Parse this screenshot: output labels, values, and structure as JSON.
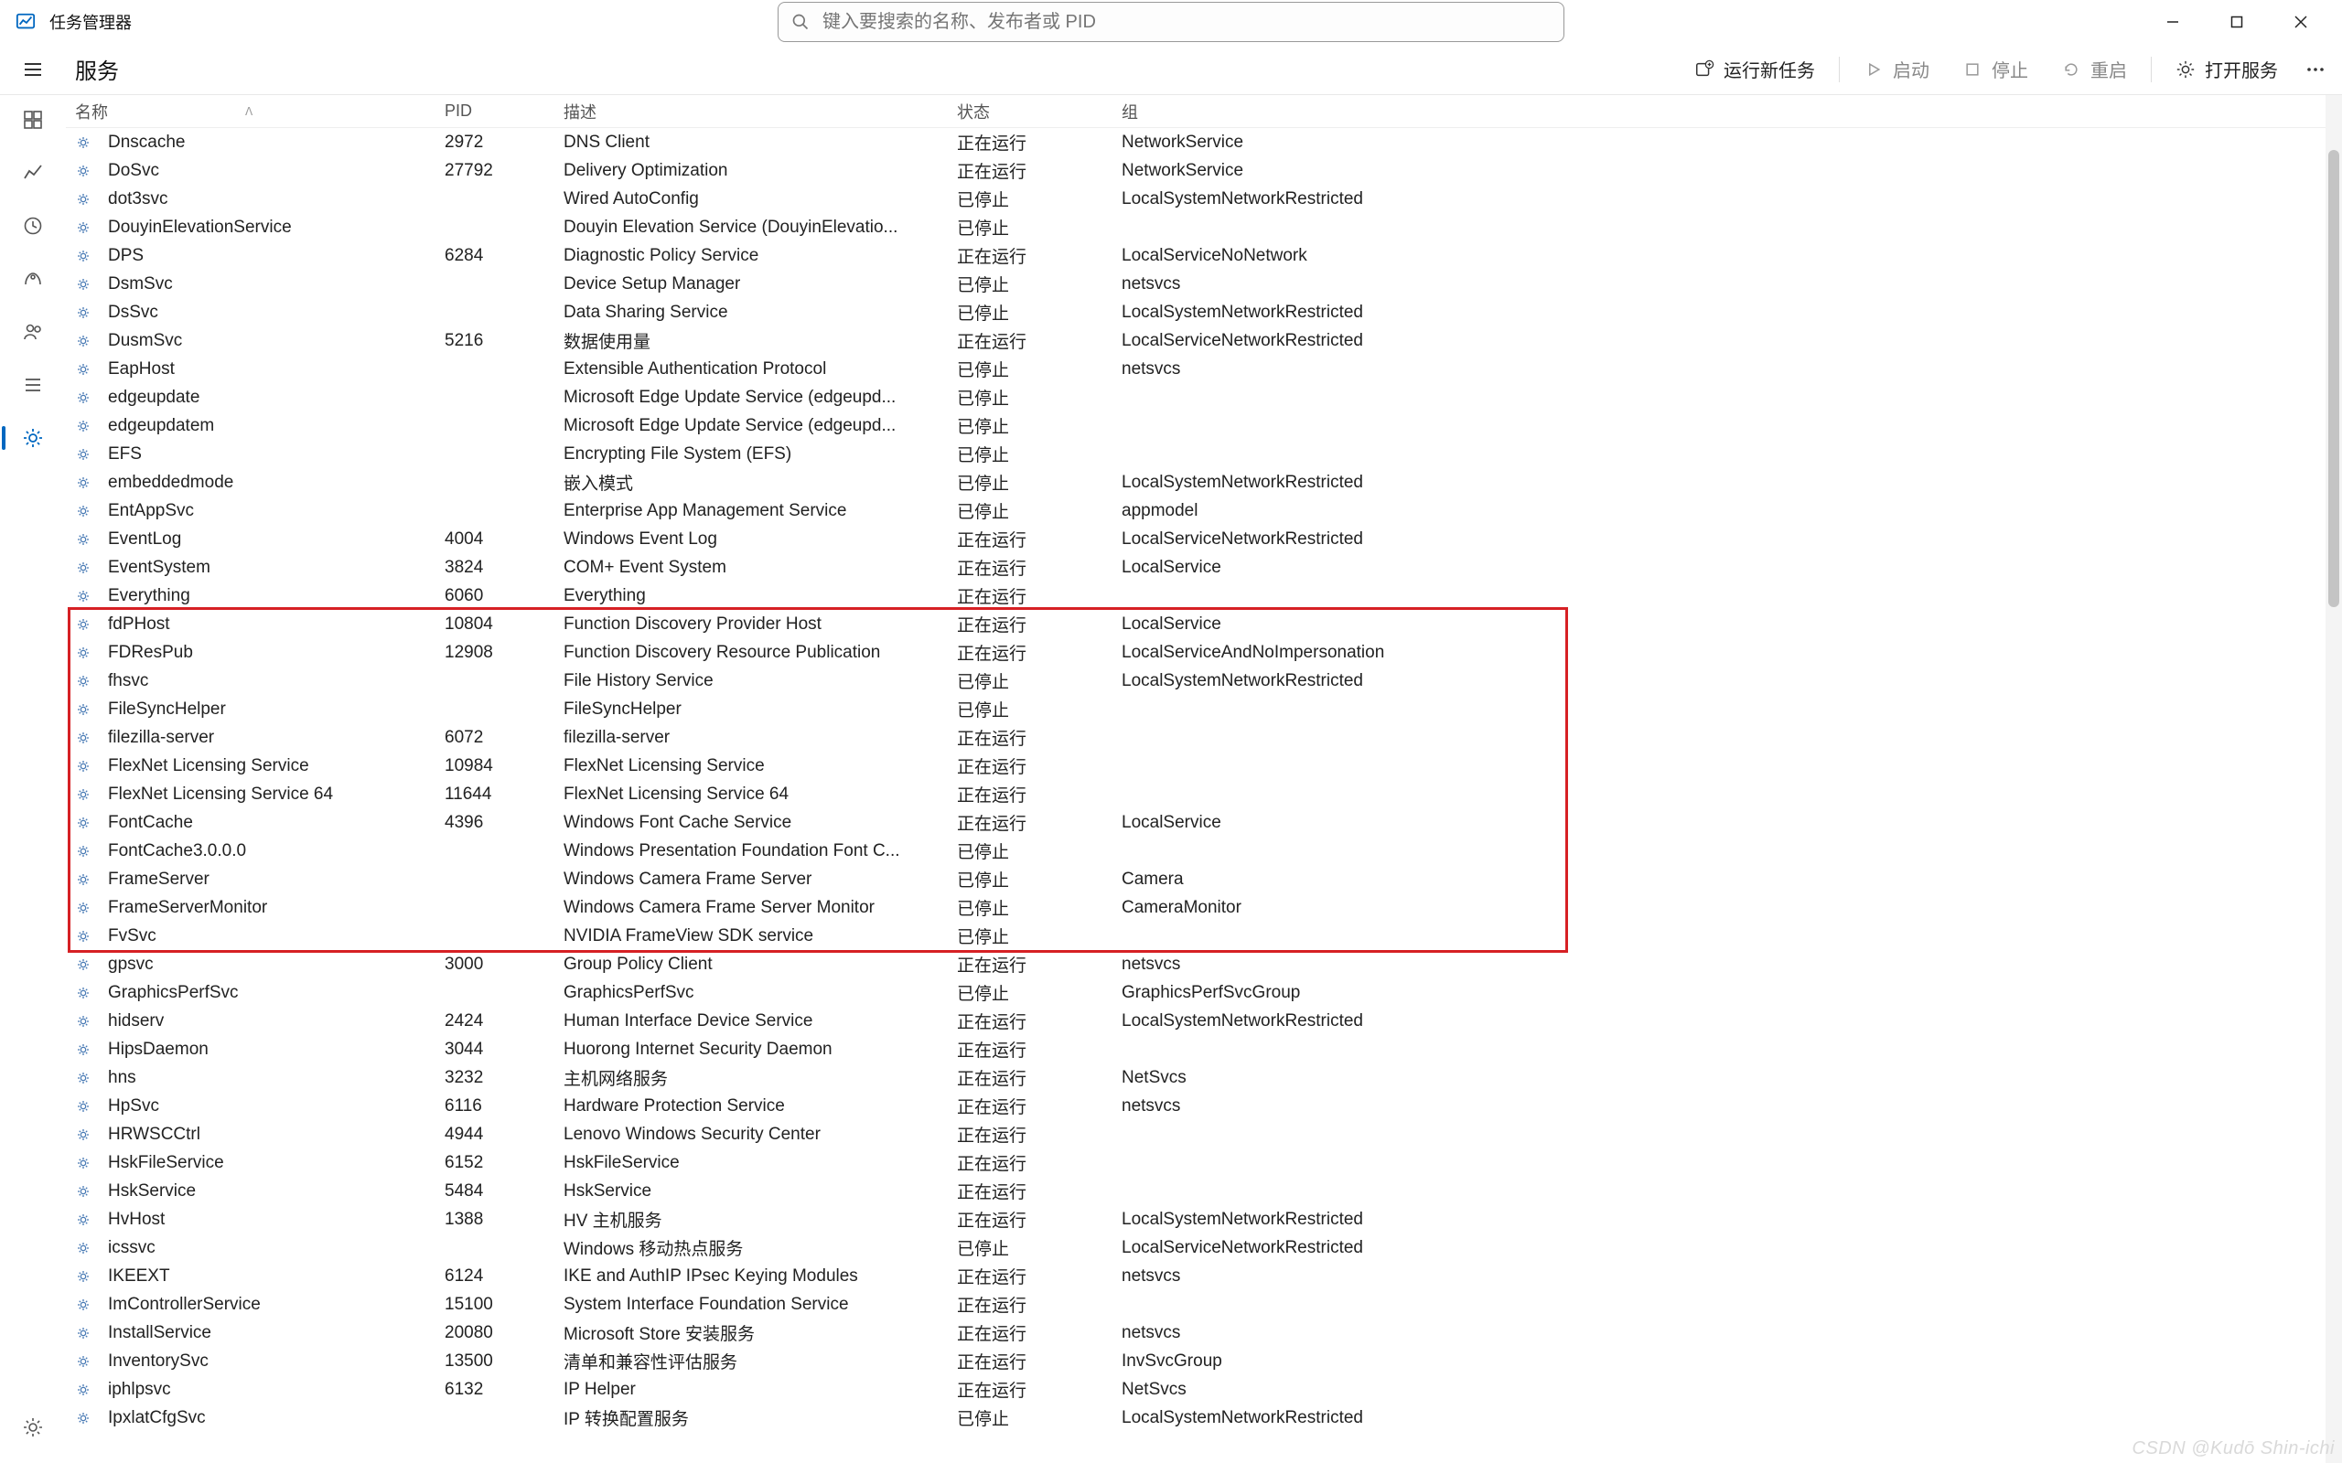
{
  "window": {
    "title": "任务管理器"
  },
  "search": {
    "placeholder": "键入要搜索的名称、发布者或 PID"
  },
  "page": {
    "title": "服务"
  },
  "actions": {
    "new_task": "运行新任务",
    "start": "启动",
    "stop": "停止",
    "restart": "重启",
    "open_services": "打开服务"
  },
  "columns": {
    "name": "名称",
    "pid": "PID",
    "desc": "描述",
    "status": "状态",
    "group": "组"
  },
  "status_labels": {
    "running": "正在运行",
    "stopped": "已停止"
  },
  "watermark": "CSDN @Kudō Shin-ichi",
  "highlight": {
    "startIndex": 17,
    "endIndex": 28
  },
  "services": [
    {
      "name": "Dnscache",
      "pid": "2972",
      "desc": "DNS Client",
      "status": "running",
      "group": "NetworkService"
    },
    {
      "name": "DoSvc",
      "pid": "27792",
      "desc": "Delivery Optimization",
      "status": "running",
      "group": "NetworkService"
    },
    {
      "name": "dot3svc",
      "pid": "",
      "desc": "Wired AutoConfig",
      "status": "stopped",
      "group": "LocalSystemNetworkRestricted"
    },
    {
      "name": "DouyinElevationService",
      "pid": "",
      "desc": "Douyin Elevation Service (DouyinElevatio...",
      "status": "stopped",
      "group": ""
    },
    {
      "name": "DPS",
      "pid": "6284",
      "desc": "Diagnostic Policy Service",
      "status": "running",
      "group": "LocalServiceNoNetwork"
    },
    {
      "name": "DsmSvc",
      "pid": "",
      "desc": "Device Setup Manager",
      "status": "stopped",
      "group": "netsvcs"
    },
    {
      "name": "DsSvc",
      "pid": "",
      "desc": "Data Sharing Service",
      "status": "stopped",
      "group": "LocalSystemNetworkRestricted"
    },
    {
      "name": "DusmSvc",
      "pid": "5216",
      "desc": "数据使用量",
      "status": "running",
      "group": "LocalServiceNetworkRestricted"
    },
    {
      "name": "EapHost",
      "pid": "",
      "desc": "Extensible Authentication Protocol",
      "status": "stopped",
      "group": "netsvcs"
    },
    {
      "name": "edgeupdate",
      "pid": "",
      "desc": "Microsoft Edge Update Service (edgeupd...",
      "status": "stopped",
      "group": ""
    },
    {
      "name": "edgeupdatem",
      "pid": "",
      "desc": "Microsoft Edge Update Service (edgeupd...",
      "status": "stopped",
      "group": ""
    },
    {
      "name": "EFS",
      "pid": "",
      "desc": "Encrypting File System (EFS)",
      "status": "stopped",
      "group": ""
    },
    {
      "name": "embeddedmode",
      "pid": "",
      "desc": "嵌入模式",
      "status": "stopped",
      "group": "LocalSystemNetworkRestricted"
    },
    {
      "name": "EntAppSvc",
      "pid": "",
      "desc": "Enterprise App Management Service",
      "status": "stopped",
      "group": "appmodel"
    },
    {
      "name": "EventLog",
      "pid": "4004",
      "desc": "Windows Event Log",
      "status": "running",
      "group": "LocalServiceNetworkRestricted"
    },
    {
      "name": "EventSystem",
      "pid": "3824",
      "desc": "COM+ Event System",
      "status": "running",
      "group": "LocalService"
    },
    {
      "name": "Everything",
      "pid": "6060",
      "desc": "Everything",
      "status": "running",
      "group": ""
    },
    {
      "name": "fdPHost",
      "pid": "10804",
      "desc": "Function Discovery Provider Host",
      "status": "running",
      "group": "LocalService"
    },
    {
      "name": "FDResPub",
      "pid": "12908",
      "desc": "Function Discovery Resource Publication",
      "status": "running",
      "group": "LocalServiceAndNoImpersonation"
    },
    {
      "name": "fhsvc",
      "pid": "",
      "desc": "File History Service",
      "status": "stopped",
      "group": "LocalSystemNetworkRestricted"
    },
    {
      "name": "FileSyncHelper",
      "pid": "",
      "desc": "FileSyncHelper",
      "status": "stopped",
      "group": ""
    },
    {
      "name": "filezilla-server",
      "pid": "6072",
      "desc": "filezilla-server",
      "status": "running",
      "group": ""
    },
    {
      "name": "FlexNet Licensing Service",
      "pid": "10984",
      "desc": "FlexNet Licensing Service",
      "status": "running",
      "group": ""
    },
    {
      "name": "FlexNet Licensing Service 64",
      "pid": "11644",
      "desc": "FlexNet Licensing Service 64",
      "status": "running",
      "group": ""
    },
    {
      "name": "FontCache",
      "pid": "4396",
      "desc": "Windows Font Cache Service",
      "status": "running",
      "group": "LocalService"
    },
    {
      "name": "FontCache3.0.0.0",
      "pid": "",
      "desc": "Windows Presentation Foundation Font C...",
      "status": "stopped",
      "group": ""
    },
    {
      "name": "FrameServer",
      "pid": "",
      "desc": "Windows Camera Frame Server",
      "status": "stopped",
      "group": "Camera"
    },
    {
      "name": "FrameServerMonitor",
      "pid": "",
      "desc": "Windows Camera Frame Server Monitor",
      "status": "stopped",
      "group": "CameraMonitor"
    },
    {
      "name": "FvSvc",
      "pid": "",
      "desc": "NVIDIA FrameView SDK service",
      "status": "stopped",
      "group": ""
    },
    {
      "name": "gpsvc",
      "pid": "3000",
      "desc": "Group Policy Client",
      "status": "running",
      "group": "netsvcs"
    },
    {
      "name": "GraphicsPerfSvc",
      "pid": "",
      "desc": "GraphicsPerfSvc",
      "status": "stopped",
      "group": "GraphicsPerfSvcGroup"
    },
    {
      "name": "hidserv",
      "pid": "2424",
      "desc": "Human Interface Device Service",
      "status": "running",
      "group": "LocalSystemNetworkRestricted"
    },
    {
      "name": "HipsDaemon",
      "pid": "3044",
      "desc": "Huorong Internet Security Daemon",
      "status": "running",
      "group": ""
    },
    {
      "name": "hns",
      "pid": "3232",
      "desc": "主机网络服务",
      "status": "running",
      "group": "NetSvcs"
    },
    {
      "name": "HpSvc",
      "pid": "6116",
      "desc": "Hardware Protection Service",
      "status": "running",
      "group": "netsvcs"
    },
    {
      "name": "HRWSCCtrl",
      "pid": "4944",
      "desc": "Lenovo Windows Security Center",
      "status": "running",
      "group": ""
    },
    {
      "name": "HskFileService",
      "pid": "6152",
      "desc": "HskFileService",
      "status": "running",
      "group": ""
    },
    {
      "name": "HskService",
      "pid": "5484",
      "desc": "HskService",
      "status": "running",
      "group": ""
    },
    {
      "name": "HvHost",
      "pid": "1388",
      "desc": "HV 主机服务",
      "status": "running",
      "group": "LocalSystemNetworkRestricted"
    },
    {
      "name": "icssvc",
      "pid": "",
      "desc": "Windows 移动热点服务",
      "status": "stopped",
      "group": "LocalServiceNetworkRestricted"
    },
    {
      "name": "IKEEXT",
      "pid": "6124",
      "desc": "IKE and AuthIP IPsec Keying Modules",
      "status": "running",
      "group": "netsvcs"
    },
    {
      "name": "ImControllerService",
      "pid": "15100",
      "desc": "System Interface Foundation Service",
      "status": "running",
      "group": ""
    },
    {
      "name": "InstallService",
      "pid": "20080",
      "desc": "Microsoft Store 安装服务",
      "status": "running",
      "group": "netsvcs"
    },
    {
      "name": "InventorySvc",
      "pid": "13500",
      "desc": "清单和兼容性评估服务",
      "status": "running",
      "group": "InvSvcGroup"
    },
    {
      "name": "iphlpsvc",
      "pid": "6132",
      "desc": "IP Helper",
      "status": "running",
      "group": "NetSvcs"
    },
    {
      "name": "IpxlatCfgSvc",
      "pid": "",
      "desc": "IP 转换配置服务",
      "status": "stopped",
      "group": "LocalSystemNetworkRestricted"
    }
  ]
}
